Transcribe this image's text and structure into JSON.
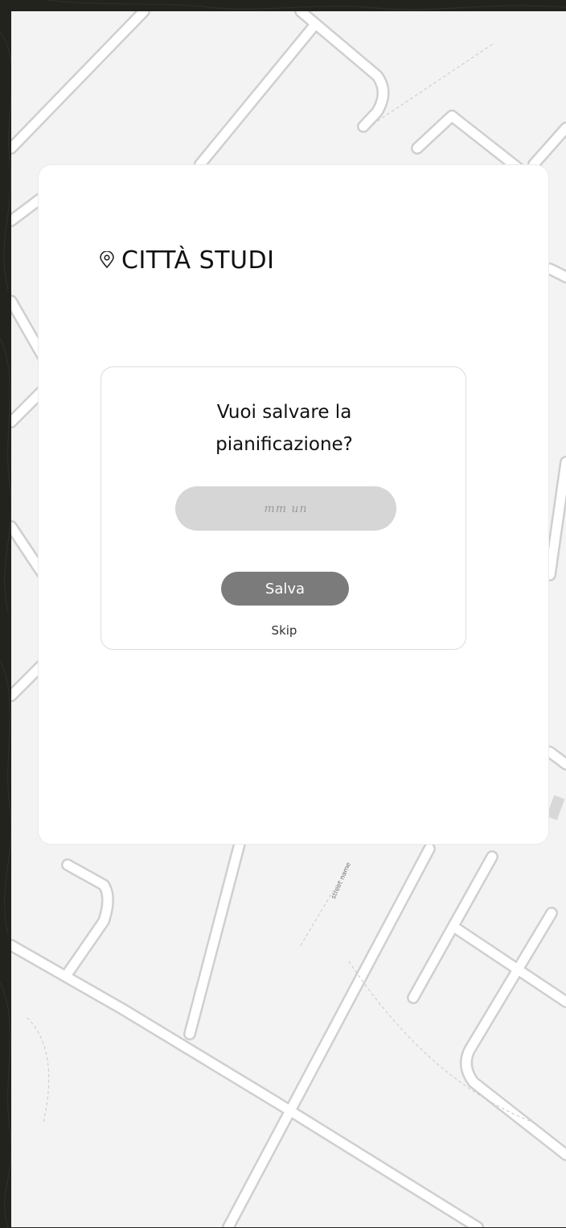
{
  "background": {
    "street_label": "street name"
  },
  "location": {
    "icon": "map-pin-icon",
    "title": "CITTÀ STUDI"
  },
  "dialog": {
    "question_line1": "Vuoi salvare la",
    "question_line2": "pianificazione?",
    "input_scribble": "mm un",
    "save_label": "Salva",
    "skip_label": "Skip"
  },
  "colors": {
    "frame": "#22231d",
    "map": "#f3f3f3",
    "card": "#ffffff",
    "input": "#d6d6d6",
    "button": "#7b7b7b"
  }
}
